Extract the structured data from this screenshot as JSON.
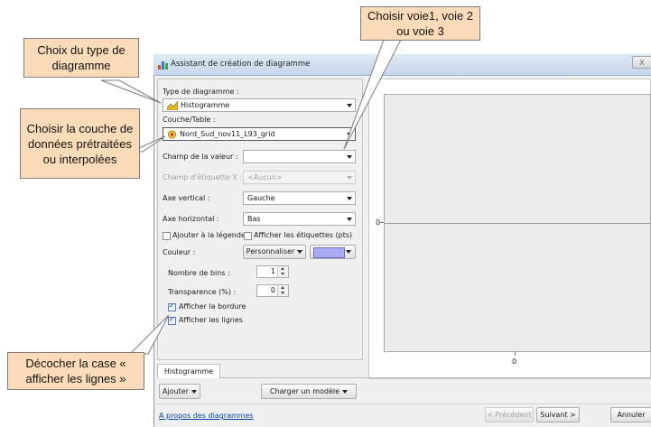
{
  "window": {
    "title": "Assistant de création de diagramme",
    "close_glyph": "X"
  },
  "form": {
    "chart_type_label": "Type de diagramme :",
    "chart_type_value": "Histogramme",
    "layer_label": "Couche/Table :",
    "layer_value": "Nord_Sud_nov11_L93_grid",
    "value_field_label": "Champ de la valeur :",
    "value_field_value": "",
    "label_field_label": "Champ d'étiquette X :",
    "label_field_value": "<Aucun>",
    "v_axis_label": "Axe vertical :",
    "v_axis_value": "Gauche",
    "h_axis_label": "Axe horizontal :",
    "h_axis_value": "Bas",
    "add_legend_label": "Ajouter à la légende",
    "add_legend_checked": false,
    "show_labels_label": "Afficher les étiquettes (pts)",
    "show_labels_checked": false,
    "color_label": "Couleur :",
    "color_mode_value": "Personnaliser",
    "color_swatch": "#a9a9f4",
    "bins_label": "Nombre de bins :",
    "bins_value": "1",
    "transparency_label": "Transparence (%) :",
    "transparency_value": "0",
    "show_border_label": "Afficher la bordure",
    "show_border_checked": true,
    "show_lines_label": "Afficher les lignes",
    "show_lines_checked": true
  },
  "tabs": [
    {
      "label": "Histogramme"
    }
  ],
  "buttons": {
    "add": "Ajouter",
    "load_model": "Charger un modèle",
    "previous": "< Précédent",
    "next": "Suivant >",
    "cancel": "Annuler"
  },
  "about_link": "A propos des diagrammes",
  "preview": {
    "y_tick": "0",
    "x_tick": "0",
    "plot_bg": "#ececec"
  },
  "callouts": {
    "chart_type": "Choix du type de diagramme",
    "layer": "Choisir la couche de données prétraitées ou interpolées",
    "lane": "Choisir voie1, voie 2 ou voie 3",
    "lines": "Décocher la case « afficher les lignes »"
  }
}
